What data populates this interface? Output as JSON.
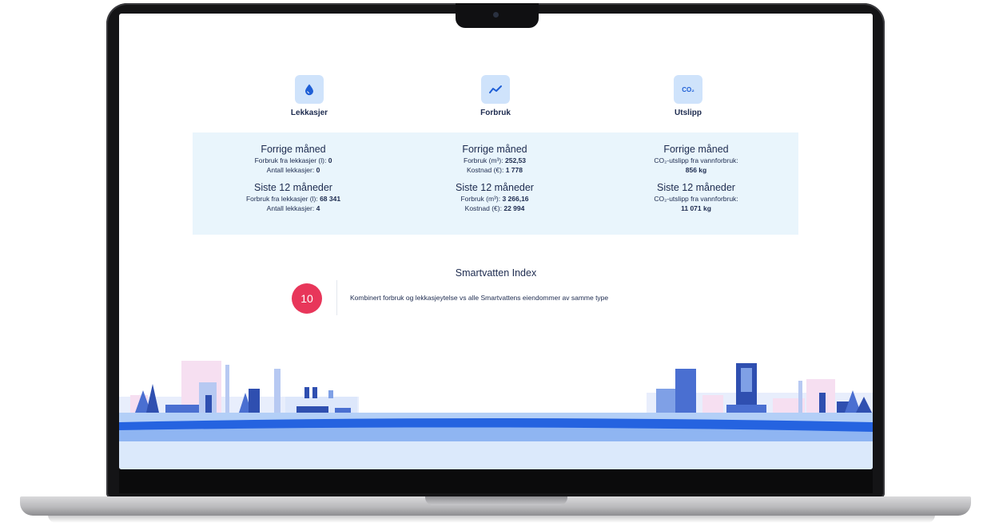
{
  "categories": [
    {
      "label": "Lekkasjer",
      "icon": "water-drop-icon"
    },
    {
      "label": "Forbruk",
      "icon": "trend-line-icon"
    },
    {
      "label": "Utslipp",
      "icon": "co2-icon",
      "icon_text": "CO₂"
    }
  ],
  "stats": {
    "leaks": {
      "prev_heading": "Forrige måned",
      "prev_line1_label": "Forbruk fra lekkasjer (l):",
      "prev_line1_value": "0",
      "prev_line2_label": "Antall lekkasjer:",
      "prev_line2_value": "0",
      "year_heading": "Siste 12 måneder",
      "year_line1_label": "Forbruk fra lekkasjer (l):",
      "year_line1_value": "68 341",
      "year_line2_label": "Antall lekkasjer:",
      "year_line2_value": "4"
    },
    "consumption": {
      "prev_heading": "Forrige måned",
      "prev_line1_label": "Forbruk (m³):",
      "prev_line1_value": "252,53",
      "prev_line2_label": "Kostnad (€):",
      "prev_line2_value": "1 778",
      "year_heading": "Siste 12 måneder",
      "year_line1_label": "Forbruk (m³):",
      "year_line1_value": "3 266,16",
      "year_line2_label": "Kostnad (€):",
      "year_line2_value": "22 994"
    },
    "emissions": {
      "prev_heading": "Forrige måned",
      "prev_line1_label": "CO₂-utslipp fra vannforbruk:",
      "prev_line2_value": "856 kg",
      "year_heading": "Siste 12 måneder",
      "year_line1_label": "CO₂-utslipp fra vannforbruk:",
      "year_line2_value": "11 071 kg"
    }
  },
  "index": {
    "title": "Smartvatten Index",
    "score": "10",
    "description": "Kombinert forbruk og lekkasjeytelse vs alle Smartvattens eiendommer av samme type"
  },
  "colors": {
    "accent_blue": "#1f5fd6",
    "panel_bg": "#e9f5fc",
    "icon_bg": "#cfe3fb",
    "badge": "#e8365a",
    "text": "#1d2b4f"
  }
}
